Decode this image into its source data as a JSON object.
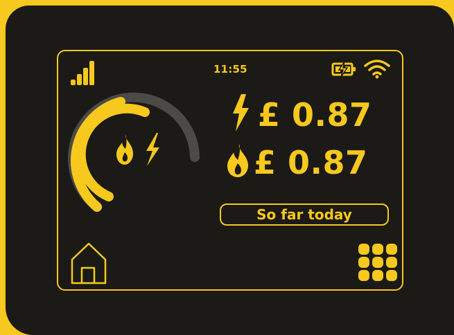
{
  "status_bar": {
    "time": "11:55",
    "signal_icon": "signal-bars-icon",
    "battery_icon": "battery-charging-icon",
    "wifi_icon": "wifi-icon"
  },
  "gauge": {
    "icons": [
      "gas-flame-icon",
      "electricity-bolt-icon"
    ]
  },
  "readings": {
    "electricity": {
      "icon": "electricity-bolt-icon",
      "amount": "£ 0.87"
    },
    "gas": {
      "icon": "gas-flame-icon",
      "amount": "£ 0.87"
    }
  },
  "period_label": "So far today",
  "nav": {
    "home_icon": "home-icon",
    "menu_icon": "grid-menu-icon"
  },
  "colors": {
    "accent": "#f7c81e",
    "background": "#1b1a17",
    "gauge_track": "#4b4a47"
  }
}
